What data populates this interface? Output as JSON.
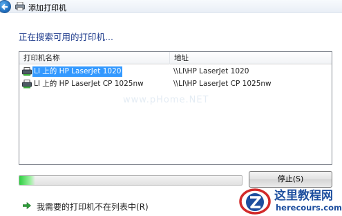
{
  "window": {
    "title": "添加打印机"
  },
  "heading": "正在搜索可用的打印机...",
  "list": {
    "columns": [
      "打印机名称",
      "地址"
    ],
    "rows": [
      {
        "name": "LI 上的 HP LaserJet 1020",
        "address": "\\\\LI\\HP LaserJet 1020",
        "selected": true,
        "icon": "printer-icon"
      },
      {
        "name": "LI 上的 HP LaserJet CP 1025nw",
        "address": "\\\\LI\\HP LaserJet CP 1025nw",
        "selected": false,
        "icon": "printer-icon"
      }
    ]
  },
  "watermark": "www.pHome.NET",
  "progress": {
    "fraction": 0.07,
    "color": "#2fcf42"
  },
  "stop_button": "停止(S)",
  "not_listed_link": "我需要的打印机不在列表中(R)",
  "logo": {
    "title": "这里教程网",
    "url": "herecours.com"
  },
  "colors": {
    "heading": "#1e3b8c",
    "selection": "#3399ff",
    "logo": "#1d4e9e"
  }
}
